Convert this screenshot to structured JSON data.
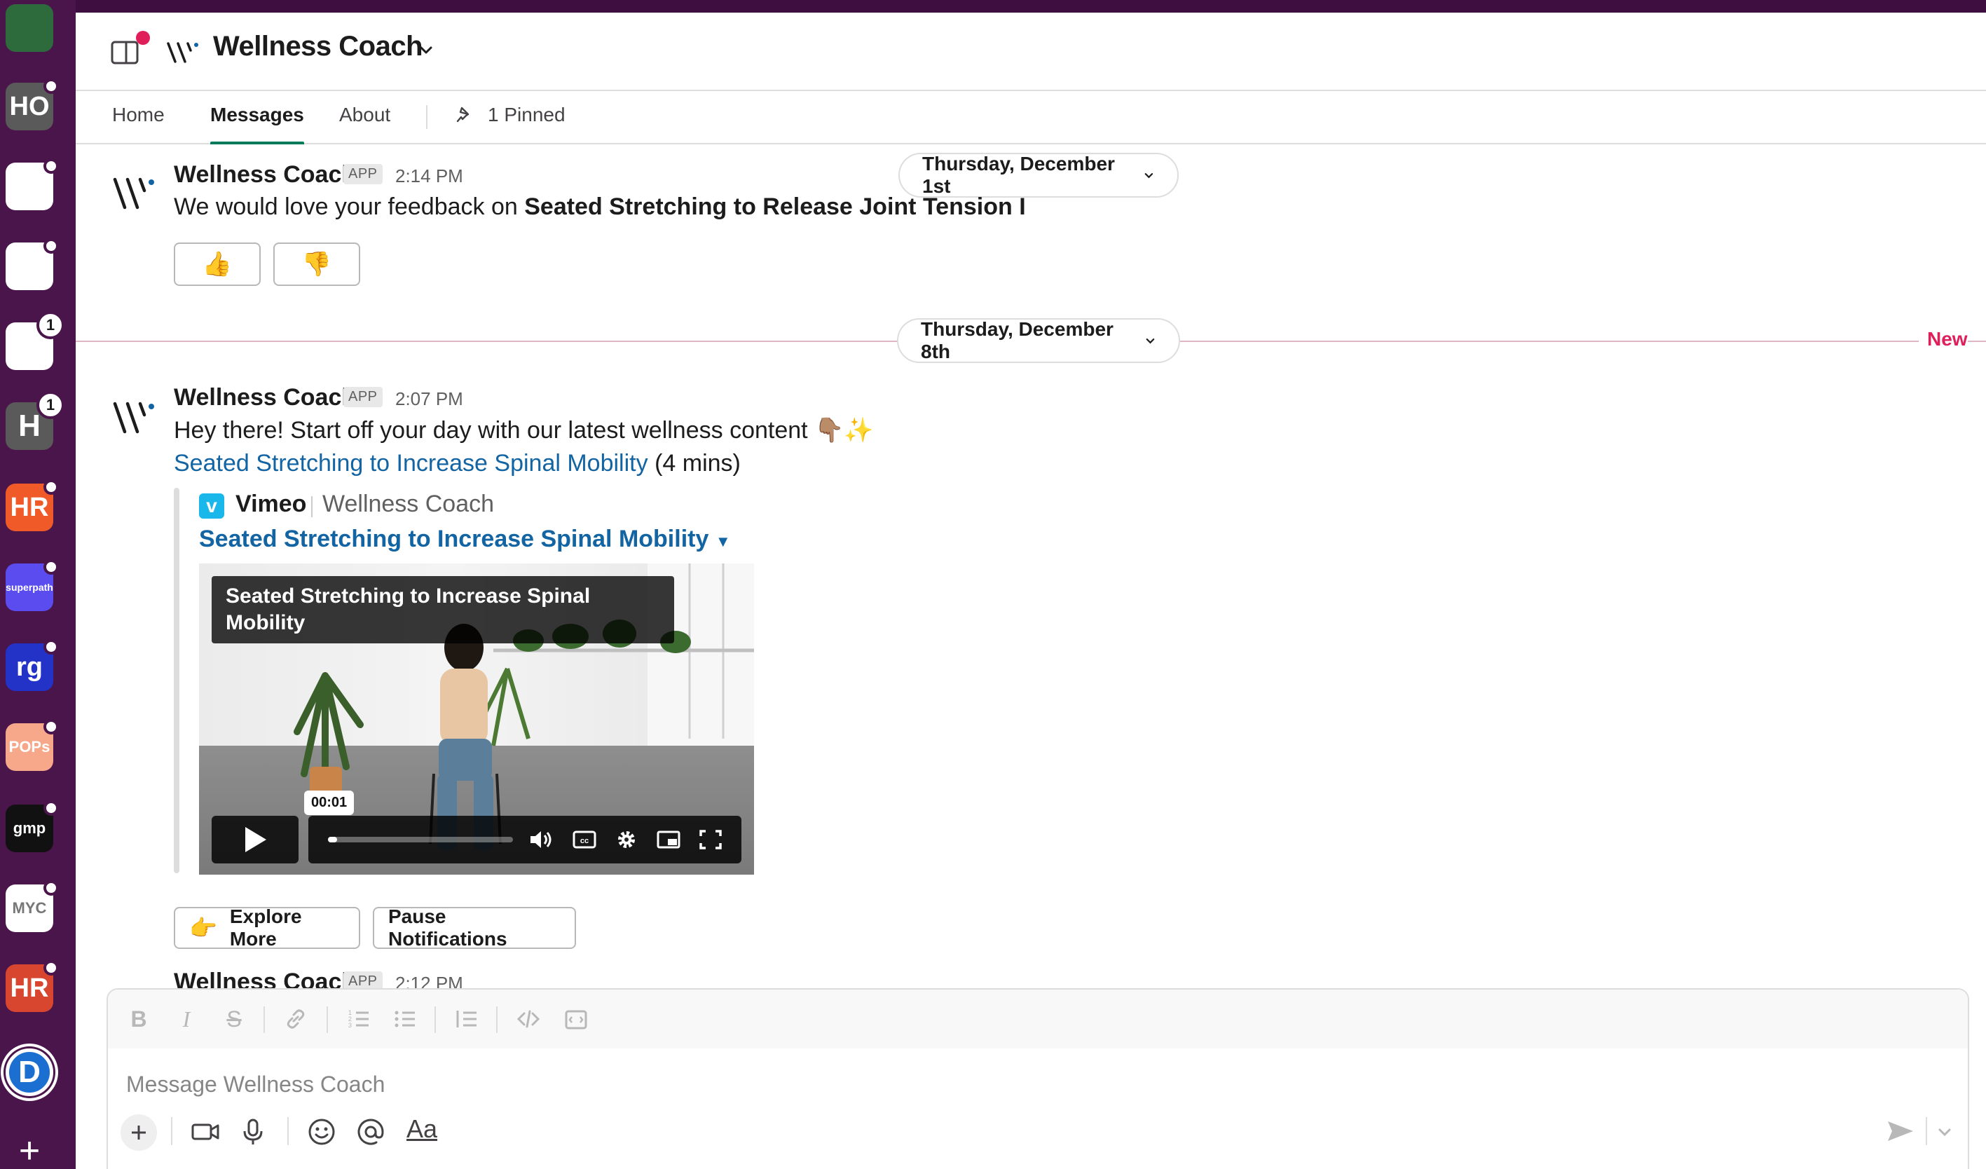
{
  "workspaces": [
    {
      "name": "workspace-1",
      "label": "",
      "bg": "#2e6b3c",
      "fg": "#ffffff",
      "dot": false
    },
    {
      "name": "workspace-ho",
      "label": "HO",
      "bg": "#5a5a5a",
      "fg": "#ffffff",
      "dot": true
    },
    {
      "name": "workspace-glasses",
      "label": "",
      "bg": "#ffffff",
      "fg": "#222222",
      "dot": true
    },
    {
      "name": "workspace-community",
      "label": "",
      "bg": "#ffffff",
      "fg": "#222222",
      "dot": true
    },
    {
      "name": "workspace-people",
      "label": "",
      "bg": "#ffffff",
      "fg": "#2bb673",
      "badge": "1"
    },
    {
      "name": "workspace-h",
      "label": "H",
      "bg": "#5a5a5a",
      "fg": "#ffffff",
      "badge": "1"
    },
    {
      "name": "workspace-hr",
      "label": "HR",
      "bg": "#f05a28",
      "fg": "#ffffff",
      "dot": true
    },
    {
      "name": "workspace-superpath",
      "label": "superpath",
      "bg": "#5b4cf0",
      "fg": "#ffffff",
      "dot": true
    },
    {
      "name": "workspace-rg",
      "label": "rg",
      "bg": "#2433c7",
      "fg": "#ffffff",
      "dot": true
    },
    {
      "name": "workspace-pops",
      "label": "POPs",
      "bg": "#f7a88a",
      "fg": "#ffffff",
      "dot": true
    },
    {
      "name": "workspace-gmp",
      "label": "gmp",
      "bg": "#111111",
      "fg": "#ffffff",
      "dot": true
    },
    {
      "name": "workspace-myc",
      "label": "MYC",
      "bg": "#ffffff",
      "fg": "#777777",
      "dot": true
    },
    {
      "name": "workspace-hr-mavericks",
      "label": "HR",
      "bg": "#d8462f",
      "fg": "#ffffff",
      "dot": true
    },
    {
      "name": "workspace-d",
      "label": "D",
      "bg": "#1a6fd1",
      "fg": "#ffffff",
      "dot": false
    }
  ],
  "header": {
    "title": "Wellness Coach"
  },
  "tabs": [
    {
      "label": "Home"
    },
    {
      "label": "Messages"
    },
    {
      "label": "About"
    }
  ],
  "pinned_label": "1 Pinned",
  "day_dividers": {
    "first": "Thursday, December 1st",
    "second": "Thursday, December 8th",
    "new_label": "New"
  },
  "message1": {
    "sender": "Wellness Coach",
    "badge": "APP",
    "time": "2:14 PM",
    "text_prefix": "We would love your feedback on ",
    "text_bold": "Seated Stretching to Release Joint Tension I",
    "thumbs_up": "👍",
    "thumbs_down": "👎"
  },
  "message2": {
    "sender": "Wellness Coach",
    "badge": "APP",
    "time": "2:07 PM",
    "text": "Hey there! Start off your day with our latest wellness content 👇🏽✨",
    "link_text": "Seated Stretching to Increase Spinal Mobility",
    "duration": "(4 mins)",
    "attachment": {
      "provider": "Vimeo",
      "author": "Wellness Coach",
      "title": "Seated Stretching to Increase Spinal Mobility",
      "video_overlay_title": "Seated Stretching to Increase Spinal Mobility",
      "timestamp": "00:01",
      "progress": 0.05
    },
    "explore_emoji": "👉",
    "explore_label": "Explore More",
    "pause_label": "Pause Notifications"
  },
  "message3": {
    "sender": "Wellness Coach",
    "badge": "APP",
    "time": "2:12 PM"
  },
  "composer": {
    "placeholder": "Message Wellness Coach",
    "aa_label": "Aa"
  }
}
